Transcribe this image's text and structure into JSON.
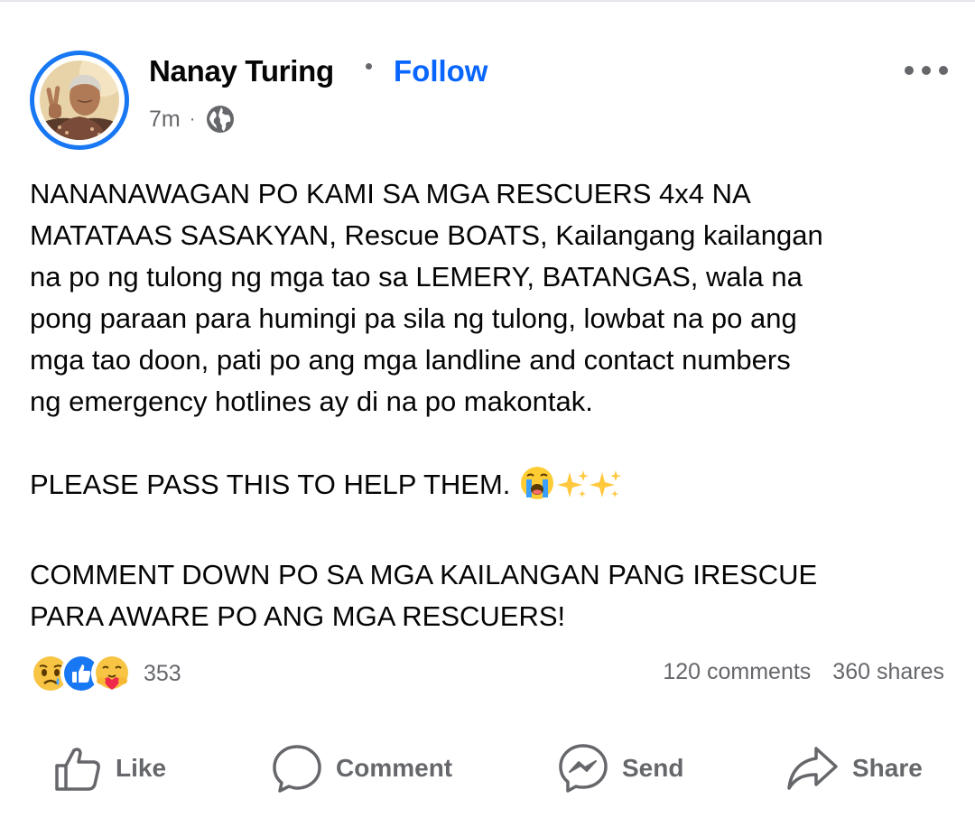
{
  "post": {
    "author_name": "Nanay Turing",
    "follow_label": "Follow",
    "timestamp": "7m",
    "meta_separator": "·",
    "privacy_icon": "globe-icon",
    "more_icon": "more-horizontal-icon",
    "paragraphs": [
      "NANANAWAGAN PO KAMI SA MGA RESCUERS 4x4 NA\nMATATAAS SASAKYAN, Rescue BOATS, Kailangang kailangan\nna po ng tulong ng mga tao sa LEMERY, BATANGAS, wala na\npong paraan para humingi pa sila ng tulong, lowbat na po ang\nmga tao doon, pati po ang mga landline and contact numbers\nng emergency hotlines ay di na po makontak.",
      "PLEASE PASS THIS TO HELP THEM.",
      "COMMENT DOWN PO SA MGA KAILANGAN PANG IRESCUE\nPARA AWARE PO ANG MGA RESCUERS!"
    ],
    "paragraph2_emojis": [
      "loudly-crying-face-emoji",
      "sparkles-emoji",
      "sparkles-emoji"
    ]
  },
  "reactions": {
    "icons": [
      "sad-reaction-icon",
      "like-reaction-icon",
      "care-reaction-icon"
    ],
    "count": "353"
  },
  "stats": {
    "comments": "120 comments",
    "shares": "360 shares"
  },
  "actions": {
    "like": "Like",
    "comment": "Comment",
    "send": "Send",
    "share": "Share"
  },
  "colors": {
    "accent": "#0866ff",
    "secondary_text": "#65676b",
    "primary_text": "#050505",
    "avatar_ring": "#1877f2"
  }
}
